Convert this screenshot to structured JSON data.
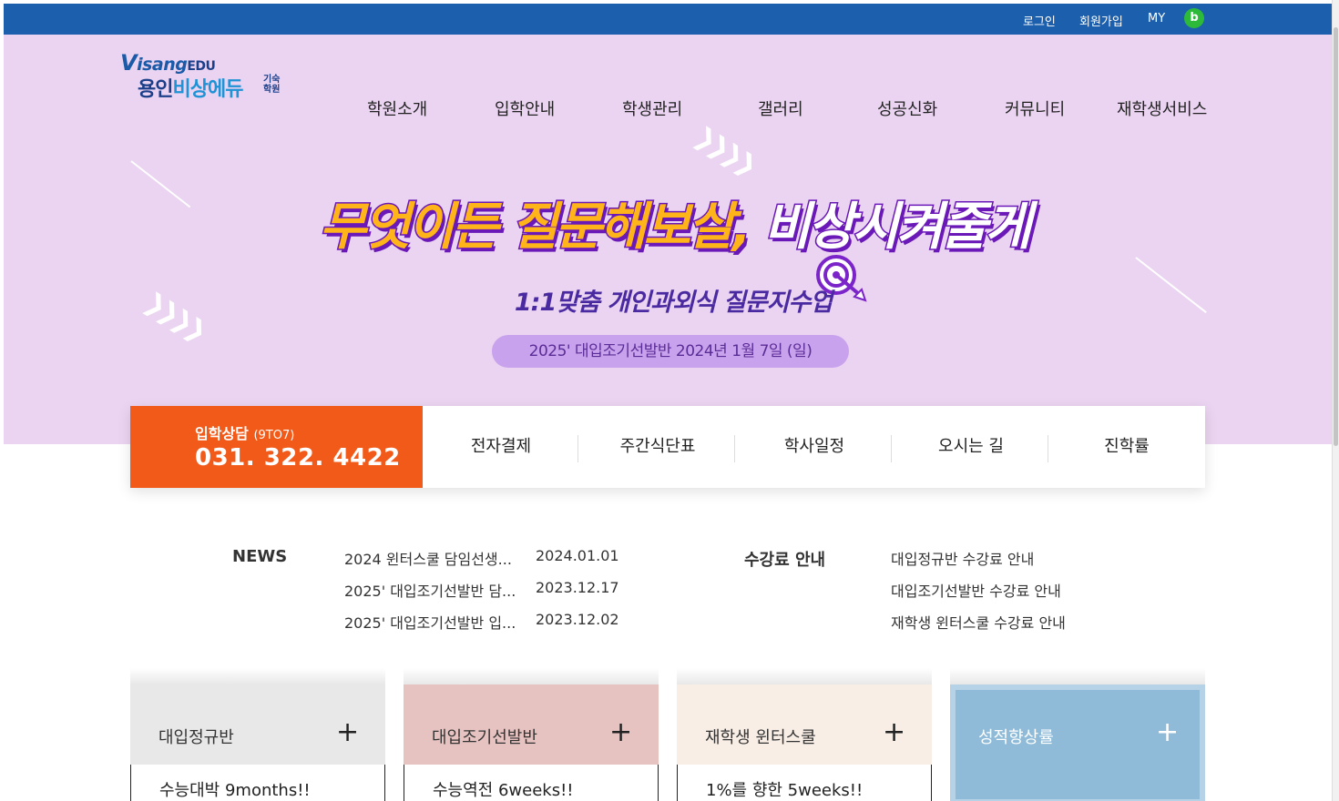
{
  "topbar": {
    "login": "로그인",
    "signup": "회원가입",
    "my": "MY",
    "blog_icon": "b",
    "bg_color": "#1c5fad"
  },
  "logo": {
    "brand_v": "V",
    "brand_rest": "isang",
    "brand_edu": "EDU",
    "name_a": "용인",
    "name_b": "비상에듀",
    "sub": "기숙학원"
  },
  "gnb": [
    "학원소개",
    "입학안내",
    "학생관리",
    "갤러리",
    "성공신화",
    "커뮤니티",
    "재학생서비스"
  ],
  "hero": {
    "headline_a": "무엇이든 질문해보살,",
    "headline_b": "비상시켜줄게",
    "subline": "1:1맞춤 개인과외식 질문지수업",
    "pill": "2025' 대입조기선발반   2024년 1월 7일 (일)",
    "bg_color": "#ebd4f1"
  },
  "quick": {
    "call_title": "입학상담",
    "call_hours": "(9TO7)",
    "call_phone": "031. 322. 4422",
    "links": [
      "전자결제",
      "주간식단표",
      "학사일정",
      "오시는 길",
      "진학률"
    ],
    "accent": "#f25a1a"
  },
  "news": {
    "title": "NEWS",
    "items": [
      {
        "title": "2024 윈터스쿨 담임선생...",
        "date": "2024.01.01"
      },
      {
        "title": "2025' 대입조기선발반 담...",
        "date": "2023.12.17"
      },
      {
        "title": "2025' 대입조기선발반 입...",
        "date": "2023.12.02"
      }
    ]
  },
  "fees": {
    "title": "수강료 안내",
    "items": [
      "대입정규반 수강료 안내",
      "대입조기선발반 수강료 안내",
      "재학생 윈터스쿨 수강료 안내"
    ]
  },
  "cards": [
    {
      "label": "대입정규반",
      "body": "수능대박 9months!!",
      "color": "#e8e8e8"
    },
    {
      "label": "대입조기선발반",
      "body": "수능역전 6weeks!!",
      "color": "#e6c3c1"
    },
    {
      "label": "재학생 윈터스쿨",
      "body": "1%를 향한 5weeks!!",
      "color": "#f8eee6"
    },
    {
      "label": "성적향상률",
      "body": "",
      "color": "#8fbbd8"
    }
  ],
  "plus_icon": "+"
}
